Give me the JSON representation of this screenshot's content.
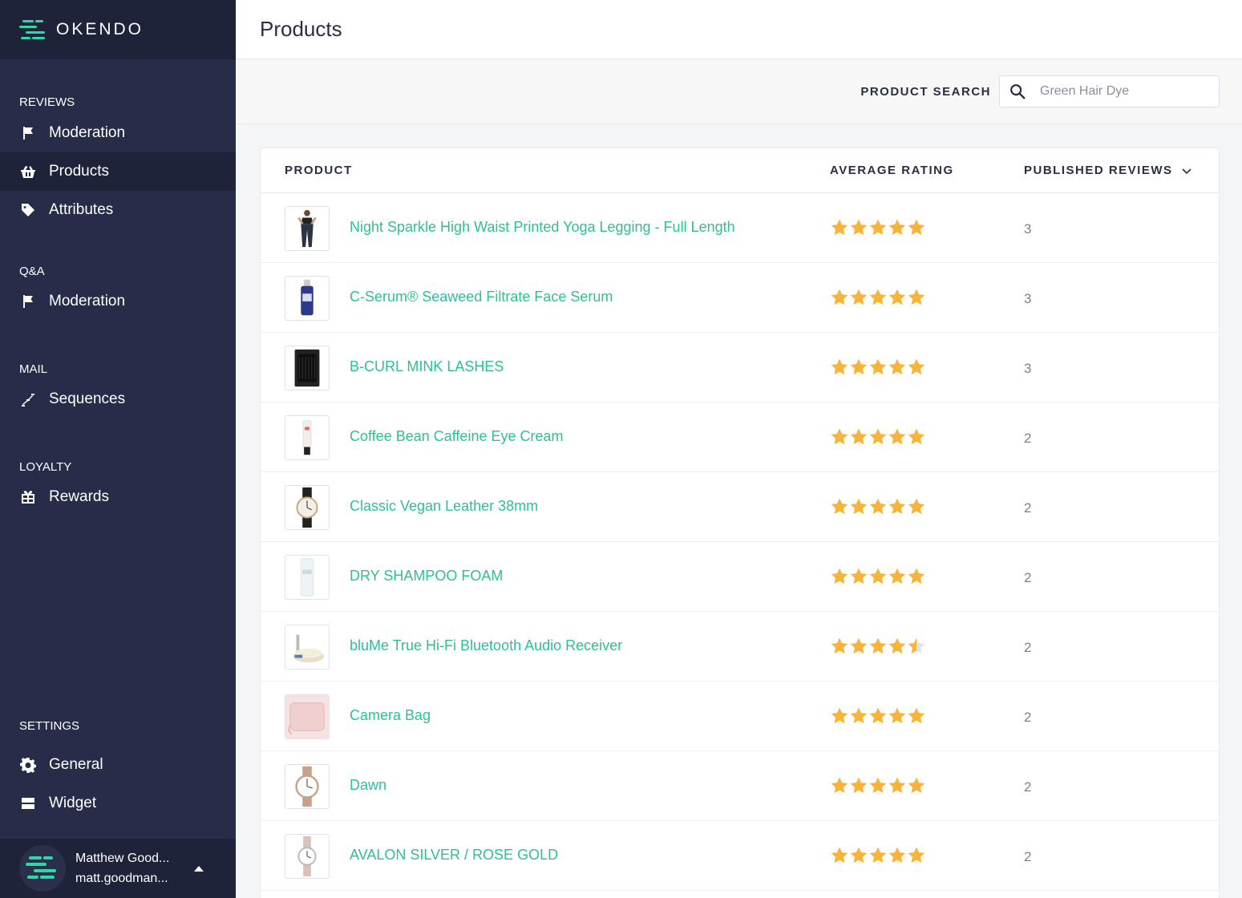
{
  "brand": {
    "name": "OKENDO",
    "accent": "#2fd6a8"
  },
  "sidebar": {
    "sections": [
      {
        "heading": "REVIEWS",
        "items": [
          {
            "label": "Moderation",
            "icon": "flag-icon",
            "active": false
          },
          {
            "label": "Products",
            "icon": "basket-icon",
            "active": true
          },
          {
            "label": "Attributes",
            "icon": "tag-icon",
            "active": false
          }
        ]
      },
      {
        "heading": "Q&A",
        "items": [
          {
            "label": "Moderation",
            "icon": "flag-icon",
            "active": false
          }
        ]
      },
      {
        "heading": "MAIL",
        "items": [
          {
            "label": "Sequences",
            "icon": "sequence-icon",
            "active": false
          }
        ]
      },
      {
        "heading": "LOYALTY",
        "items": [
          {
            "label": "Rewards",
            "icon": "gift-icon",
            "active": false
          }
        ]
      }
    ],
    "settings": {
      "heading": "SETTINGS",
      "items": [
        {
          "label": "General",
          "icon": "gear-icon"
        },
        {
          "label": "Widget",
          "icon": "widget-icon"
        }
      ]
    },
    "user": {
      "name": "Matthew Good...",
      "email": "matt.goodman..."
    }
  },
  "header": {
    "title": "Products"
  },
  "search": {
    "label": "PRODUCT SEARCH",
    "placeholder": "Green Hair Dye",
    "value": ""
  },
  "table": {
    "columns": {
      "product": "PRODUCT",
      "rating": "AVERAGE RATING",
      "reviews": "PUBLISHED REVIEWS"
    },
    "star_color": "#f6b43a",
    "star_empty_color": "#e1e3e8",
    "rows": [
      {
        "name": "Night Sparkle High Waist Printed Yoga Legging - Full Length",
        "rating": 5,
        "reviews": "3",
        "thumb": "legging"
      },
      {
        "name": "C-Serum® Seaweed Filtrate Face Serum",
        "rating": 5,
        "reviews": "3",
        "thumb": "serum"
      },
      {
        "name": "B-CURL MINK LASHES",
        "rating": 5,
        "reviews": "3",
        "thumb": "lashes"
      },
      {
        "name": "Coffee Bean Caffeine Eye Cream",
        "rating": 5,
        "reviews": "2",
        "thumb": "cream"
      },
      {
        "name": "Classic Vegan Leather 38mm",
        "rating": 5,
        "reviews": "2",
        "thumb": "watch-black"
      },
      {
        "name": "DRY SHAMPOO FOAM",
        "rating": 5,
        "reviews": "2",
        "thumb": "foam"
      },
      {
        "name": "bluMe True Hi-Fi Bluetooth Audio Receiver",
        "rating": 4.5,
        "reviews": "2",
        "thumb": "receiver"
      },
      {
        "name": "Camera Bag",
        "rating": 5,
        "reviews": "2",
        "thumb": "bag"
      },
      {
        "name": "Dawn",
        "rating": 5,
        "reviews": "2",
        "thumb": "watch-rose"
      },
      {
        "name": "AVALON SILVER / ROSE GOLD",
        "rating": 5,
        "reviews": "2",
        "thumb": "watch-silver"
      }
    ]
  }
}
